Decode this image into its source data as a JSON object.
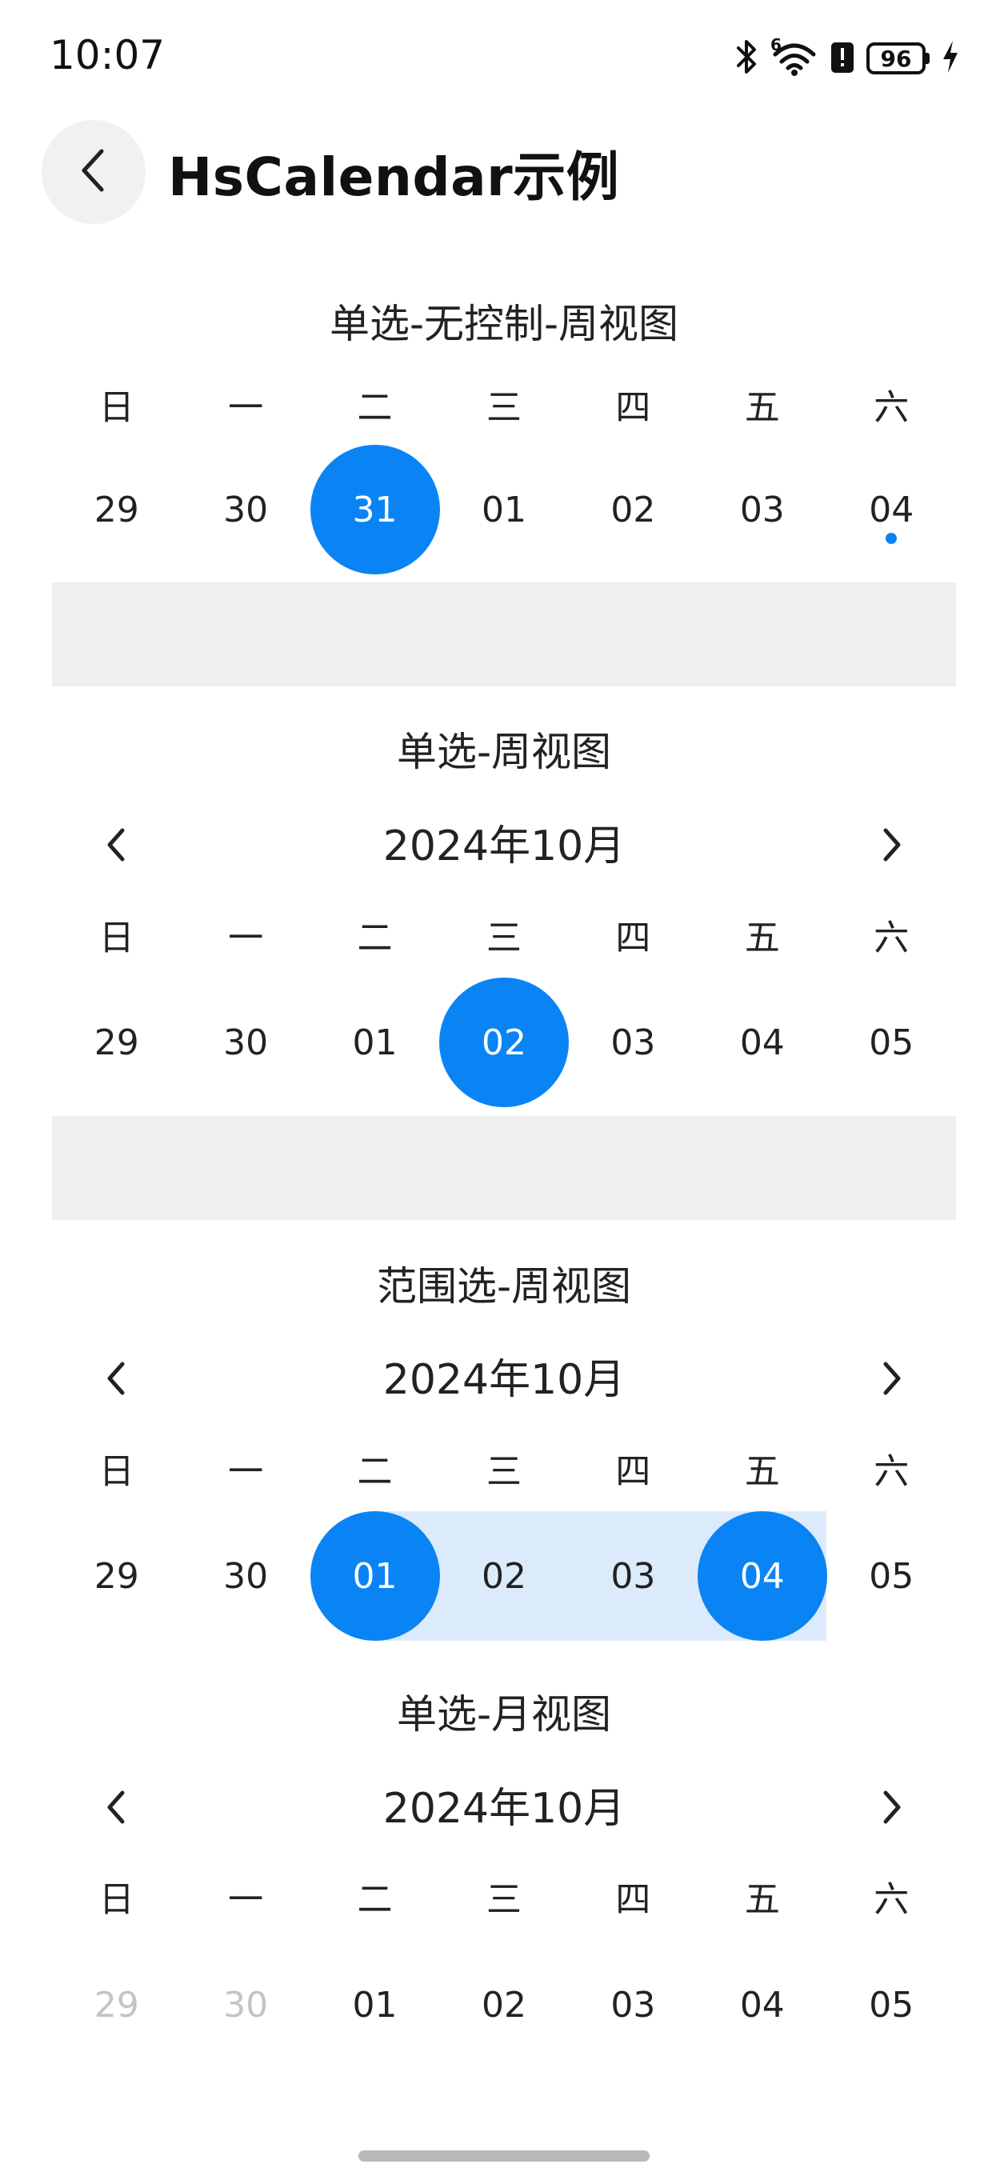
{
  "status_bar": {
    "time": "10:07",
    "icons": [
      "bluetooth-icon",
      "wifi-icon",
      "alert-icon",
      "battery-icon",
      "charging-icon"
    ],
    "wifi_superscript": "6",
    "battery": "96"
  },
  "header": {
    "back_icon": "chevron-left-icon",
    "title": "HsCalendar示例"
  },
  "colors": {
    "accent": "#0a84f5",
    "range_fill": "#dcebfb",
    "panel_grey": "#efefef",
    "muted_text": "#c4c4c4"
  },
  "weekdays": [
    "日",
    "一",
    "二",
    "三",
    "四",
    "五",
    "六"
  ],
  "sections": [
    {
      "title": "单选-无控制-周视图",
      "days": [
        "29",
        "30",
        "31",
        "01",
        "02",
        "03",
        "04"
      ],
      "selected_index": 2,
      "dot_index": 6
    },
    {
      "title": "单选-周视图",
      "month": "2024年10月",
      "days": [
        "29",
        "30",
        "01",
        "02",
        "03",
        "04",
        "05"
      ],
      "selected_index": 3
    },
    {
      "title": "范围选-周视图",
      "month": "2024年10月",
      "days": [
        "29",
        "30",
        "01",
        "02",
        "03",
        "04",
        "05"
      ],
      "range_start_index": 2,
      "range_end_index": 5
    },
    {
      "title": "单选-月视图",
      "month": "2024年10月",
      "days": [
        "29",
        "30",
        "01",
        "02",
        "03",
        "04",
        "05"
      ],
      "muted_indices": [
        0,
        1
      ]
    }
  ]
}
